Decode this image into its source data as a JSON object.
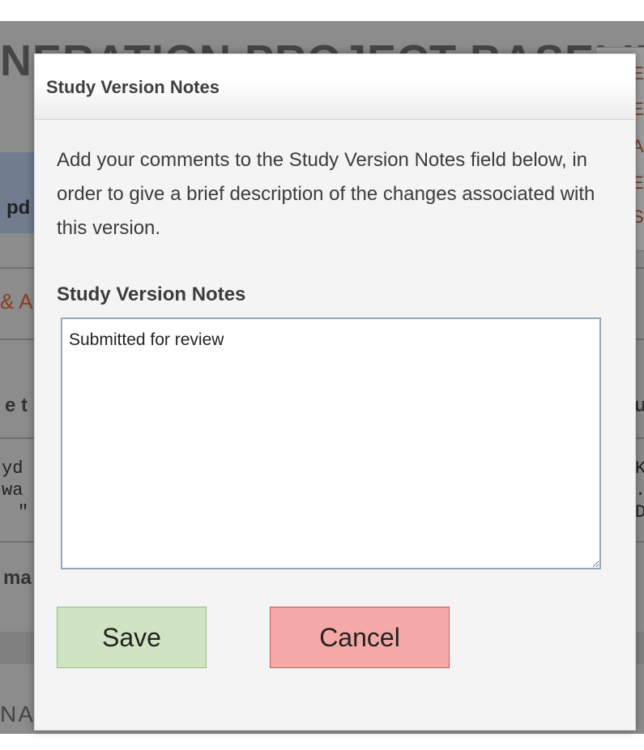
{
  "background": {
    "page_title": "NERATION PROJECT-BASELINE",
    "right_links": [
      "Ec",
      "Ec",
      "Ac",
      "Ec",
      "Su"
    ],
    "fragments": [
      "pd",
      "& A",
      "e t",
      "ma",
      "u"
    ],
    "mono_lines_left": [
      "yd",
      "wa",
      "\""
    ],
    "mono_lines_right": [
      "Ki",
      ".",
      "DJ"
    ],
    "bottom_row_text": "NA..."
  },
  "modal": {
    "title": "Study Version Notes",
    "description": "Add your comments to the Study Version Notes field below, in order to give a brief description of the changes associated with this version.",
    "notes_label": "Study Version Notes",
    "notes_value": "Submitted for review",
    "save_label": "Save",
    "cancel_label": "Cancel"
  },
  "colors": {
    "save_bg": "#cfe4c2",
    "cancel_bg": "#f4a9a7",
    "overlay": "#8c8c8c",
    "modal_bg": "#f4f4f4"
  }
}
